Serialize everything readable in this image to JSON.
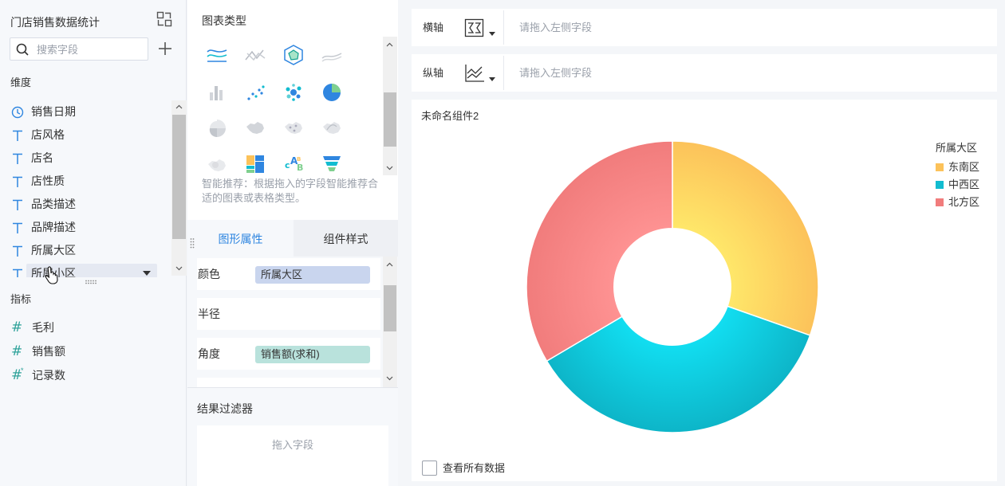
{
  "left_panel": {
    "dataset_title": "门店销售数据统计",
    "search_placeholder": "搜索字段",
    "dimensions_title": "维度",
    "dimensions": [
      {
        "label": "销售日期",
        "icon": "clock-icon"
      },
      {
        "label": "店风格",
        "icon": "text-type-icon"
      },
      {
        "label": "店名",
        "icon": "text-type-icon"
      },
      {
        "label": "店性质",
        "icon": "text-type-icon"
      },
      {
        "label": "品类描述",
        "icon": "text-type-icon"
      },
      {
        "label": "品牌描述",
        "icon": "text-type-icon"
      },
      {
        "label": "所属大区",
        "icon": "text-type-icon"
      },
      {
        "label": "所属小区",
        "icon": "text-type-icon"
      }
    ],
    "measures_title": "指标",
    "measures": [
      {
        "label": "毛利"
      },
      {
        "label": "销售额"
      },
      {
        "label": "记录数"
      }
    ]
  },
  "middle_panel": {
    "chart_type_title": "图表类型",
    "smart_tip": "智能推荐：根据拖入的字段智能推荐合适的图表或表格类型。",
    "tabs": {
      "shape": "图形属性",
      "style": "组件样式"
    },
    "props": {
      "color_label": "颜色",
      "color_value": "所属大区",
      "radius_label": "半径",
      "angle_label": "角度",
      "angle_value": "销售额(求和)"
    },
    "filter_title": "结果过滤器",
    "filter_hint": "拖入字段"
  },
  "canvas": {
    "x_axis_label": "横轴",
    "y_axis_label": "纵轴",
    "axis_hint": "请拖入左侧字段",
    "widget_title": "未命名组件2",
    "view_all_label": "查看所有数据"
  },
  "colors": {
    "accent": "#2f86e0",
    "pill_color": "#c9d5ee",
    "pill_angle": "#b9e2dc",
    "measure_icon": "#2ea29a"
  },
  "chart_data": {
    "type": "pie",
    "title": "",
    "legend_title": "所属大区",
    "legend_position": "top-right",
    "inner_radius_ratio": 0.4,
    "categories": [
      "东南区",
      "中西区",
      "北方区"
    ],
    "values": [
      0.304,
      0.361,
      0.335
    ],
    "colors": [
      "#fcc25a",
      "#12bcd0",
      "#f17c7c"
    ]
  }
}
